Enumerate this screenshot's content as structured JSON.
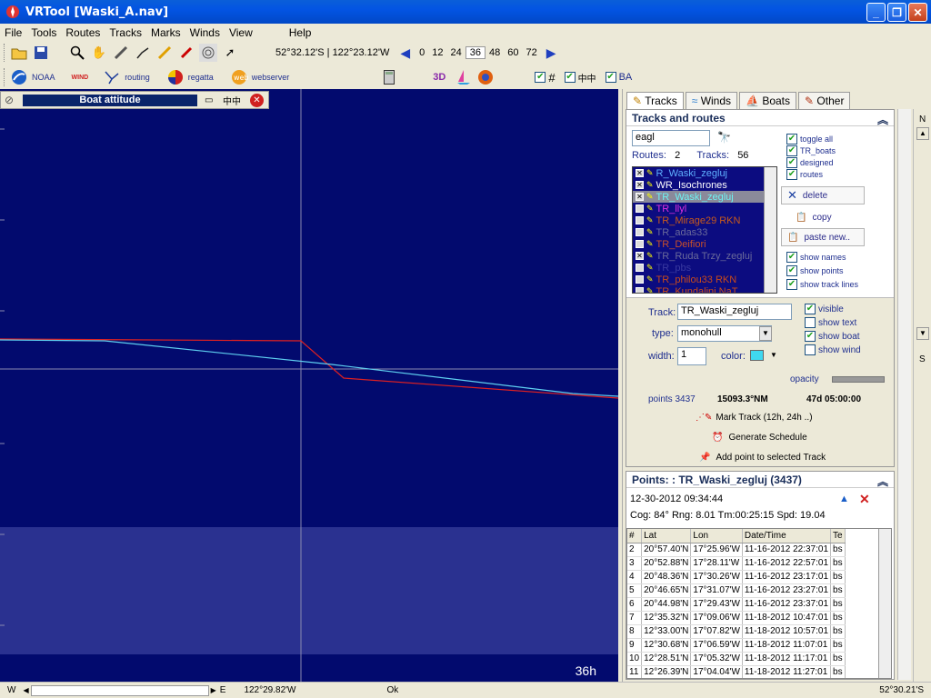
{
  "window": {
    "title": "VRTool [Waski_A.nav]"
  },
  "menu": [
    "File",
    "Tools",
    "Routes",
    "Tracks",
    "Marks",
    "Winds",
    "View",
    "Help"
  ],
  "toolbar": {
    "coords": "52°32.12'S | 122°23.12'W",
    "hours": [
      "0",
      "12",
      "24",
      "36",
      "48",
      "60",
      "72"
    ],
    "selected_hour": "36"
  },
  "toolbar2": {
    "noaa": "NOAA",
    "wind": "WIND",
    "routing": "routing",
    "regatta": "regatta",
    "webserver": "webserver",
    "threed": "3D",
    "ba": "BA"
  },
  "attitude": {
    "title": "Boat attitude"
  },
  "map": {
    "hours_label": "36h"
  },
  "tabs": [
    "Tracks",
    "Winds",
    "Boats",
    "Other"
  ],
  "tracks_panel": {
    "title": "Tracks and routes",
    "search": "eagl",
    "routes_label": "Routes:",
    "routes_count": "2",
    "tracks_label": "Tracks:",
    "tracks_count": "56",
    "items": [
      {
        "label": "R_Waski_zegluj",
        "color": "#5fb0ff",
        "checked": true
      },
      {
        "label": "WR_Isochrones",
        "color": "#ffffff",
        "checked": true
      },
      {
        "label": "TR_Waski_zegluj",
        "color": "#6df2f2",
        "checked": true
      },
      {
        "label": "TR_llyl",
        "color": "#e030e0",
        "checked": false
      },
      {
        "label": "TR_Mirage29 RKN",
        "color": "#c85a1a",
        "checked": false
      },
      {
        "label": "TR_adas33",
        "color": "#6a6a9a",
        "checked": false
      },
      {
        "label": "TR_Deifiori",
        "color": "#c8502a",
        "checked": false
      },
      {
        "label": "TR_Ruda Trzy_zegluj",
        "color": "#6a6a9a",
        "checked": true
      },
      {
        "label": "TR_pbs",
        "color": "#3a3aa0",
        "checked": false
      },
      {
        "label": "TR_philou33 RKN",
        "color": "#c84a1a",
        "checked": false
      },
      {
        "label": "TR_Kundalini NaT",
        "color": "#c84a1a",
        "checked": false
      }
    ],
    "toggles": [
      "toggle all",
      "TR_boats",
      "designed",
      "routes"
    ],
    "delete": "delete",
    "copy": "copy",
    "paste": "paste new..",
    "show_names": "show names",
    "show_points": "show points",
    "show_track_lines": "show track lines"
  },
  "track_form": {
    "track_label": "Track:",
    "track_value": "TR_Waski_zegluj",
    "type_label": "type:",
    "type_value": "monohull",
    "width_label": "width:",
    "width_value": "1",
    "color_label": "color:",
    "color_value": "#3fd8f0",
    "visible": "visible",
    "show_text": "show text",
    "show_boat": "show boat",
    "show_wind": "show wind",
    "opacity": "opacity",
    "points_label": "points",
    "points_value": "3437",
    "distance": "15093.3°NM",
    "duration": "47d 05:00:00",
    "mark_track": "Mark Track (12h, 24h ..)",
    "generate": "Generate Schedule",
    "add_point": "Add point to selected Track"
  },
  "points_panel": {
    "title": "Points: : TR_Waski_zegluj (3437)",
    "timestamp": "12-30-2012 09:34:44",
    "summary": "Cog: 84° Rng:  8.01 Tm:00:25:15 Spd: 19.04",
    "columns": [
      "#",
      "Lat",
      "Lon",
      "Date/Time",
      "Te"
    ],
    "rows": [
      [
        "2",
        "20°57.40'N",
        "17°25.96'W",
        "11-16-2012 22:37:01",
        "bs"
      ],
      [
        "3",
        "20°52.88'N",
        "17°28.11'W",
        "11-16-2012 22:57:01",
        "bs"
      ],
      [
        "4",
        "20°48.36'N",
        "17°30.26'W",
        "11-16-2012 23:17:01",
        "bs"
      ],
      [
        "5",
        "20°46.65'N",
        "17°31.07'W",
        "11-16-2012 23:27:01",
        "bs"
      ],
      [
        "6",
        "20°44.98'N",
        "17°29.43'W",
        "11-16-2012 23:37:01",
        "bs"
      ],
      [
        "7",
        "12°35.32'N",
        "17°09.06'W",
        "11-18-2012 10:47:01",
        "bs"
      ],
      [
        "8",
        "12°33.00'N",
        "17°07.82'W",
        "11-18-2012 10:57:01",
        "bs"
      ],
      [
        "9",
        "12°30.68'N",
        "17°06.59'W",
        "11-18-2012 11:07:01",
        "bs"
      ],
      [
        "10",
        "12°28.51'N",
        "17°05.32'W",
        "11-18-2012 11:17:01",
        "bs"
      ],
      [
        "11",
        "12°26.39'N",
        "17°04.04'W",
        "11-18-2012 11:27:01",
        "bs"
      ]
    ]
  },
  "nav": {
    "n": "N",
    "s": "S"
  },
  "statusbar": {
    "w": "W",
    "e": "E",
    "lon": "122°29.82'W",
    "ok": "Ok",
    "lat": "52°30.21'S"
  }
}
